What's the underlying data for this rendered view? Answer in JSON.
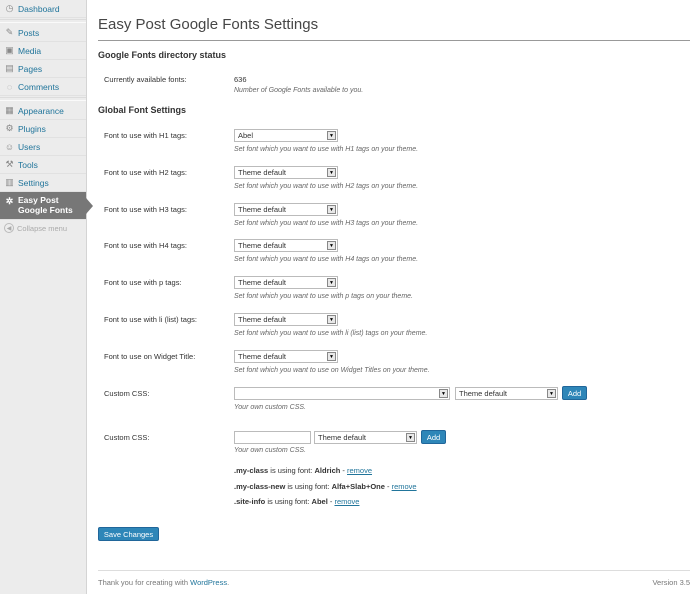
{
  "sidebar": {
    "items": [
      {
        "label": "Dashboard",
        "icon": "dashboard-icon"
      },
      {
        "label": "Posts",
        "icon": "pin-icon"
      },
      {
        "label": "Media",
        "icon": "media-icon"
      },
      {
        "label": "Pages",
        "icon": "page-icon"
      },
      {
        "label": "Comments",
        "icon": "comment-icon"
      },
      {
        "label": "Appearance",
        "icon": "appearance-icon"
      },
      {
        "label": "Plugins",
        "icon": "plugin-icon"
      },
      {
        "label": "Users",
        "icon": "users-icon"
      },
      {
        "label": "Tools",
        "icon": "tools-icon"
      },
      {
        "label": "Settings",
        "icon": "settings-icon"
      },
      {
        "label": "Easy Post Google Fonts",
        "icon": "gear-icon"
      }
    ],
    "collapse_label": "Collapse menu"
  },
  "page": {
    "title": "Easy Post Google Fonts Settings",
    "status_section": "Google Fonts directory status",
    "available_label": "Currently available fonts:",
    "available_count": "636",
    "available_desc": "Number of Google Fonts available to you.",
    "global_section": "Global Font Settings"
  },
  "fonts": [
    {
      "label": "Font to use with H1 tags:",
      "value": "Abel",
      "desc": "Set font which you want to use with H1 tags on your theme."
    },
    {
      "label": "Font to use with H2 tags:",
      "value": "Theme default",
      "desc": "Set font which you want to use with H2 tags on your theme."
    },
    {
      "label": "Font to use with H3 tags:",
      "value": "Theme default",
      "desc": "Set font which you want to use with H3 tags on your theme."
    },
    {
      "label": "Font to use with H4 tags:",
      "value": "Theme default",
      "desc": "Set font which you want to use with H4 tags on your theme."
    },
    {
      "label": "Font to use with p tags:",
      "value": "Theme default",
      "desc": "Set font which you want to use with p tags on your theme."
    },
    {
      "label": "Font to use with li (list) tags:",
      "value": "Theme default",
      "desc": "Set font which you want to use with li (list) tags on your theme."
    },
    {
      "label": "Font to use on Widget Title:",
      "value": "Theme default",
      "desc": "Set font which you want to use on Widget Titles on your theme."
    }
  ],
  "custom1": {
    "label": "Custom CSS:",
    "selector_value": "",
    "font_value": "Theme default",
    "add_label": "Add",
    "desc": "Your own custom CSS."
  },
  "custom2": {
    "label": "Custom CSS:",
    "input_value": "",
    "font_value": "Theme default",
    "add_label": "Add",
    "desc": "Your own custom CSS."
  },
  "using_list": [
    {
      "selector": ".my-class",
      "mid": " is using font: ",
      "font": "Aldrich",
      "sep": " - ",
      "remove": "remove"
    },
    {
      "selector": ".my-class-new",
      "mid": " is using font: ",
      "font": "Alfa+Slab+One",
      "sep": " - ",
      "remove": "remove"
    },
    {
      "selector": ".site-info",
      "mid": " is using font: ",
      "font": "Abel",
      "sep": " - ",
      "remove": "remove"
    }
  ],
  "save_label": "Save Changes",
  "footer": {
    "thanks": "Thank you for creating with ",
    "wp_link": "WordPress",
    "period": ".",
    "version": "Version 3.5"
  },
  "colors": {
    "accent": "#21759b",
    "button": "#2e86b8",
    "sidebar_bg": "#ececec",
    "current_menu": "#777777"
  }
}
